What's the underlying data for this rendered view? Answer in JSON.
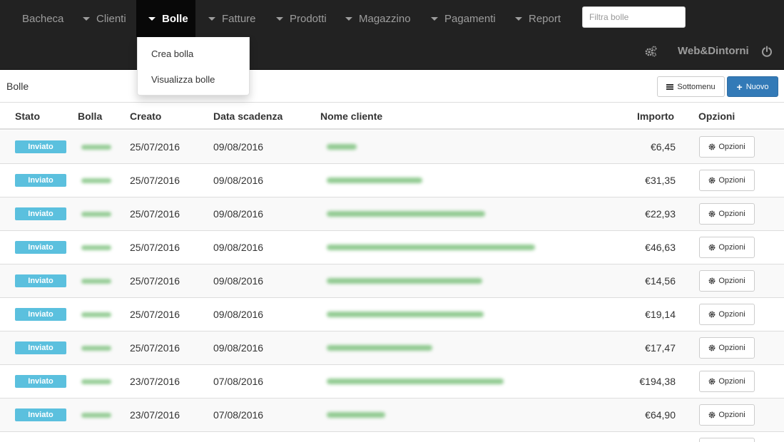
{
  "nav": {
    "items": [
      {
        "label": "Bacheca",
        "caret": false,
        "active": false,
        "x": 0
      },
      {
        "label": "Clienti",
        "caret": true,
        "active": false
      },
      {
        "label": "Bolle",
        "caret": true,
        "active": true
      },
      {
        "label": "Fatture",
        "caret": true,
        "active": false
      },
      {
        "label": "Prodotti",
        "caret": true,
        "active": false
      },
      {
        "label": "Magazzino",
        "caret": true,
        "active": false
      },
      {
        "label": "Pagamenti",
        "caret": true,
        "active": false
      },
      {
        "label": "Report",
        "caret": true,
        "active": false
      }
    ],
    "search_placeholder": "Filtra bolle",
    "company": "Web&Dintorni",
    "settings_icon": "cogs-icon",
    "logout_icon": "power-icon"
  },
  "dropdown": {
    "items": [
      "Crea bolla",
      "Visualizza bolle"
    ]
  },
  "subheader": {
    "title": "Bolle",
    "submenu_label": "Sottomenu",
    "new_label": "Nuovo"
  },
  "table": {
    "headers": [
      "Stato",
      "Bolla",
      "Creato",
      "Data scadenza",
      "Nome cliente",
      "Importo",
      "Opzioni"
    ],
    "option_label": "Opzioni",
    "rows": [
      {
        "status": "Inviato",
        "created": "25/07/2016",
        "due": "09/08/2016",
        "amount": "€6,45"
      },
      {
        "status": "Inviato",
        "created": "25/07/2016",
        "due": "09/08/2016",
        "amount": "€31,35"
      },
      {
        "status": "Inviato",
        "created": "25/07/2016",
        "due": "09/08/2016",
        "amount": "€22,93"
      },
      {
        "status": "Inviato",
        "created": "25/07/2016",
        "due": "09/08/2016",
        "amount": "€46,63"
      },
      {
        "status": "Inviato",
        "created": "25/07/2016",
        "due": "09/08/2016",
        "amount": "€14,56"
      },
      {
        "status": "Inviato",
        "created": "25/07/2016",
        "due": "09/08/2016",
        "amount": "€19,14"
      },
      {
        "status": "Inviato",
        "created": "25/07/2016",
        "due": "09/08/2016",
        "amount": "€17,47"
      },
      {
        "status": "Inviato",
        "created": "23/07/2016",
        "due": "07/08/2016",
        "amount": "€194,38"
      },
      {
        "status": "Inviato",
        "created": "23/07/2016",
        "due": "07/08/2016",
        "amount": "€64,90"
      }
    ]
  },
  "colors": {
    "navbar_bg": "#222222",
    "active_bg": "#080808",
    "badge": "#5bc0de",
    "primary": "#337ab7"
  }
}
